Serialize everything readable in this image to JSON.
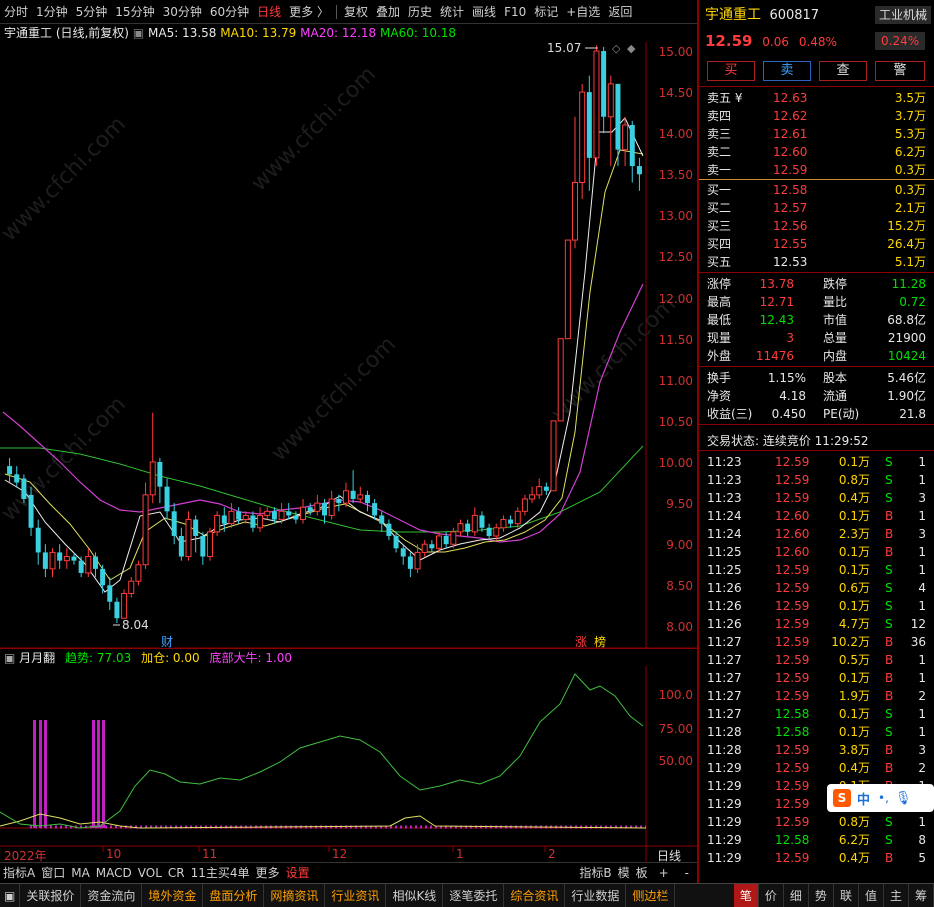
{
  "toolbar": {
    "items": [
      "分时",
      "1分钟",
      "5分钟",
      "15分钟",
      "30分钟",
      "60分钟",
      "日线",
      "更多 〉"
    ],
    "tools": [
      "复权",
      "叠加",
      "历史",
      "统计",
      "画线",
      "F10",
      "标记",
      "+自选",
      "返回"
    ]
  },
  "info": {
    "title": "宇通重工 (日线,前复权)",
    "ma5": "MA5: 13.58",
    "ma10": "MA10: 13.79",
    "ma20": "MA20: 12.18",
    "ma60": "MA60: 10.18"
  },
  "price_axis": [
    "15.00",
    "14.50",
    "14.00",
    "13.50",
    "13.00",
    "12.50",
    "12.00",
    "11.50",
    "11.00",
    "10.50",
    "10.00",
    "9.50",
    "9.00",
    "8.50",
    "8.00"
  ],
  "sub_axis": [
    "100.0",
    "75.00",
    "50.00"
  ],
  "labels": {
    "high": "15.07",
    "low": "8.04",
    "cai": "财",
    "zhang": "涨",
    "bang": "榜"
  },
  "sub": {
    "name": "月月翻",
    "trend": "趋势: 77.03",
    "add": "加仓: 0.00",
    "bottom": "底部大牛: 1.00"
  },
  "date_axis": [
    "2022年",
    "10",
    "11",
    "12",
    "1",
    "2"
  ],
  "date_mode": "日线",
  "tabs": [
    "指标A",
    "窗口",
    "MA",
    "MACD",
    "VOL",
    "CR",
    "11主买4单",
    "更多",
    "设置"
  ],
  "tabs_right": [
    "指标B",
    "模",
    "板"
  ],
  "bottom": [
    "关联报价",
    "资金流向",
    "境外资金",
    "盘面分析",
    "网摘资讯",
    "行业资讯",
    "相似K线",
    "逐笔委托",
    "综合资讯",
    "行业数据",
    "侧边栏"
  ],
  "bottom_right": [
    "笔",
    "价",
    "细",
    "势",
    "联",
    "值",
    "主",
    "筹"
  ],
  "quote": {
    "name": "宇通重工",
    "code": "600817",
    "sector": "工业机械",
    "price": "12.59",
    "change": "0.06",
    "pct": "0.48%",
    "sector_pct": "0.24%"
  },
  "buttons": [
    "买",
    "卖",
    "查",
    "警"
  ],
  "asks": [
    [
      "卖五 ¥",
      "12.63",
      "3.5万"
    ],
    [
      "卖四",
      "12.62",
      "3.7万"
    ],
    [
      "卖三",
      "12.61",
      "5.3万"
    ],
    [
      "卖二",
      "12.60",
      "6.2万"
    ],
    [
      "卖一",
      "12.59",
      "0.3万"
    ]
  ],
  "bids": [
    [
      "买一",
      "12.58",
      "0.3万"
    ],
    [
      "买二",
      "12.57",
      "2.1万"
    ],
    [
      "买三",
      "12.56",
      "15.2万"
    ],
    [
      "买四",
      "12.55",
      "26.4万"
    ],
    [
      "买五",
      "12.53",
      "5.1万"
    ]
  ],
  "stats": [
    [
      "涨停",
      "13.78",
      "跌停",
      "11.28"
    ],
    [
      "最高",
      "12.71",
      "量比",
      "0.72"
    ],
    [
      "最低",
      "12.43",
      "市值",
      "68.8亿"
    ],
    [
      "现量",
      "3",
      "总量",
      "21900"
    ],
    [
      "外盘",
      "11476",
      "内盘",
      "10424"
    ]
  ],
  "stats2": [
    [
      "换手",
      "1.15%",
      "股本",
      "5.46亿"
    ],
    [
      "净资",
      "4.18",
      "流通",
      "1.90亿"
    ],
    [
      "收益(三)",
      "0.450",
      "PE(动)",
      "21.8"
    ]
  ],
  "status": "交易状态: 连续竞价 11:29:52",
  "trades": [
    [
      "11:23",
      "12.59",
      "0.1万",
      "S",
      "1"
    ],
    [
      "11:23",
      "12.59",
      "0.8万",
      "S",
      "1"
    ],
    [
      "11:23",
      "12.59",
      "0.4万",
      "S",
      "3"
    ],
    [
      "11:24",
      "12.60",
      "0.1万",
      "B",
      "1"
    ],
    [
      "11:24",
      "12.60",
      "2.3万",
      "B",
      "3"
    ],
    [
      "11:25",
      "12.60",
      "0.1万",
      "B",
      "1"
    ],
    [
      "11:25",
      "12.59",
      "0.1万",
      "S",
      "1"
    ],
    [
      "11:26",
      "12.59",
      "0.6万",
      "S",
      "4"
    ],
    [
      "11:26",
      "12.59",
      "0.1万",
      "S",
      "1"
    ],
    [
      "11:26",
      "12.59",
      "4.7万",
      "S",
      "12"
    ],
    [
      "11:27",
      "12.59",
      "10.2万",
      "B",
      "36"
    ],
    [
      "11:27",
      "12.59",
      "0.5万",
      "B",
      "1"
    ],
    [
      "11:27",
      "12.59",
      "0.1万",
      "B",
      "1"
    ],
    [
      "11:27",
      "12.59",
      "1.9万",
      "B",
      "2"
    ],
    [
      "11:27",
      "12.58",
      "0.1万",
      "S",
      "1"
    ],
    [
      "11:28",
      "12.58",
      "0.1万",
      "S",
      "1"
    ],
    [
      "11:28",
      "12.59",
      "3.8万",
      "B",
      "3"
    ],
    [
      "11:29",
      "12.59",
      "0.4万",
      "B",
      "2"
    ],
    [
      "11:29",
      "12.59",
      "0.1万",
      "B",
      "1"
    ],
    [
      "11:29",
      "12.59",
      "0.1万",
      "B",
      "1"
    ],
    [
      "11:29",
      "12.59",
      "0.8万",
      "S",
      "1"
    ],
    [
      "11:29",
      "12.58",
      "6.2万",
      "S",
      "8"
    ],
    [
      "11:29",
      "12.59",
      "0.4万",
      "B",
      "5"
    ]
  ],
  "ime": {
    "s": "S",
    "zh": "中"
  }
}
